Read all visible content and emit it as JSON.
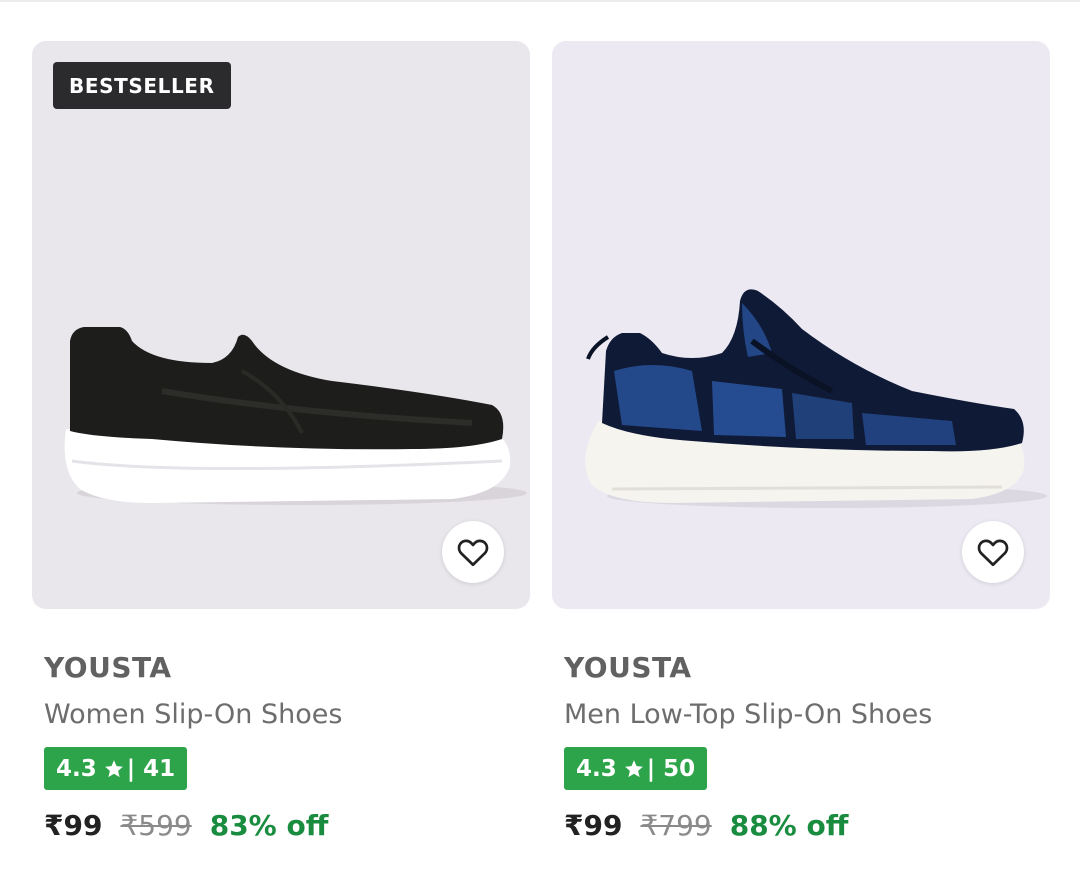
{
  "products": [
    {
      "badge": "BESTSELLER",
      "brand": "YOUSTA",
      "name": "Women Slip-On Shoes",
      "rating": "4.3",
      "separator": "|",
      "rating_count": "41",
      "price": "₹99",
      "mrp": "₹599",
      "discount": "83% off",
      "image_icon": "black-slip-on-shoe-image",
      "wishlist_icon": "heart-outline-icon"
    },
    {
      "brand": "YOUSTA",
      "name": "Men Low-Top Slip-On Shoes",
      "rating": "4.3",
      "separator": "|",
      "rating_count": "50",
      "price": "₹99",
      "mrp": "₹799",
      "discount": "88% off",
      "image_icon": "navy-blue-sneaker-image",
      "wishlist_icon": "heart-outline-icon"
    }
  ],
  "colors": {
    "rating_badge": "#2ea44a",
    "discount_text": "#198c3f",
    "bestseller_badge": "#2b2b2e"
  }
}
